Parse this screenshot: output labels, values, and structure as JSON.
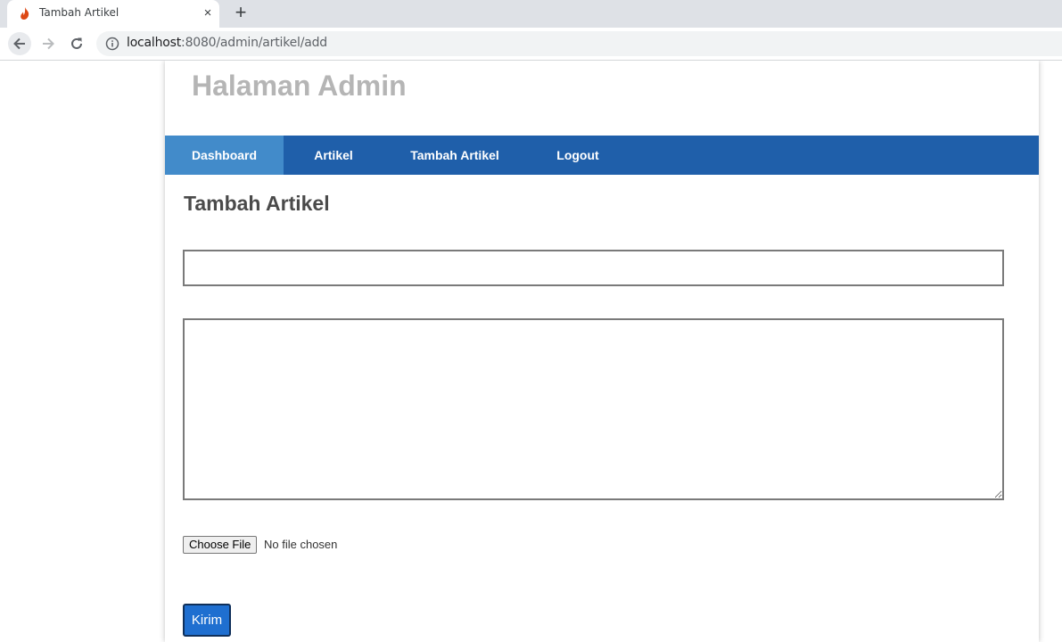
{
  "browser": {
    "tab_title": "Tambah Artikel",
    "new_tab_symbol": "+",
    "close_symbol": "×",
    "url_host": "localhost",
    "url_rest": ":8080/admin/artikel/add",
    "icons": [
      "codeigniter-flame-icon",
      "back-arrow-icon",
      "forward-arrow-icon",
      "reload-icon",
      "info-icon"
    ]
  },
  "site": {
    "title": "Halaman Admin"
  },
  "nav": {
    "items": [
      {
        "label": "Dashboard",
        "active": true
      },
      {
        "label": "Artikel",
        "active": false
      },
      {
        "label": "Tambah Artikel",
        "active": false
      },
      {
        "label": "Logout",
        "active": false
      }
    ]
  },
  "main": {
    "heading": "Tambah Artikel",
    "title_value": "",
    "body_value": "",
    "file_button_label": "Choose File",
    "file_status": "No file chosen",
    "submit_label": "Kirim"
  },
  "colors": {
    "navbar": "#1f5faa",
    "nav_active": "#428bca",
    "submit": "#1f6fd0",
    "title_gray": "#b5b5b5"
  }
}
